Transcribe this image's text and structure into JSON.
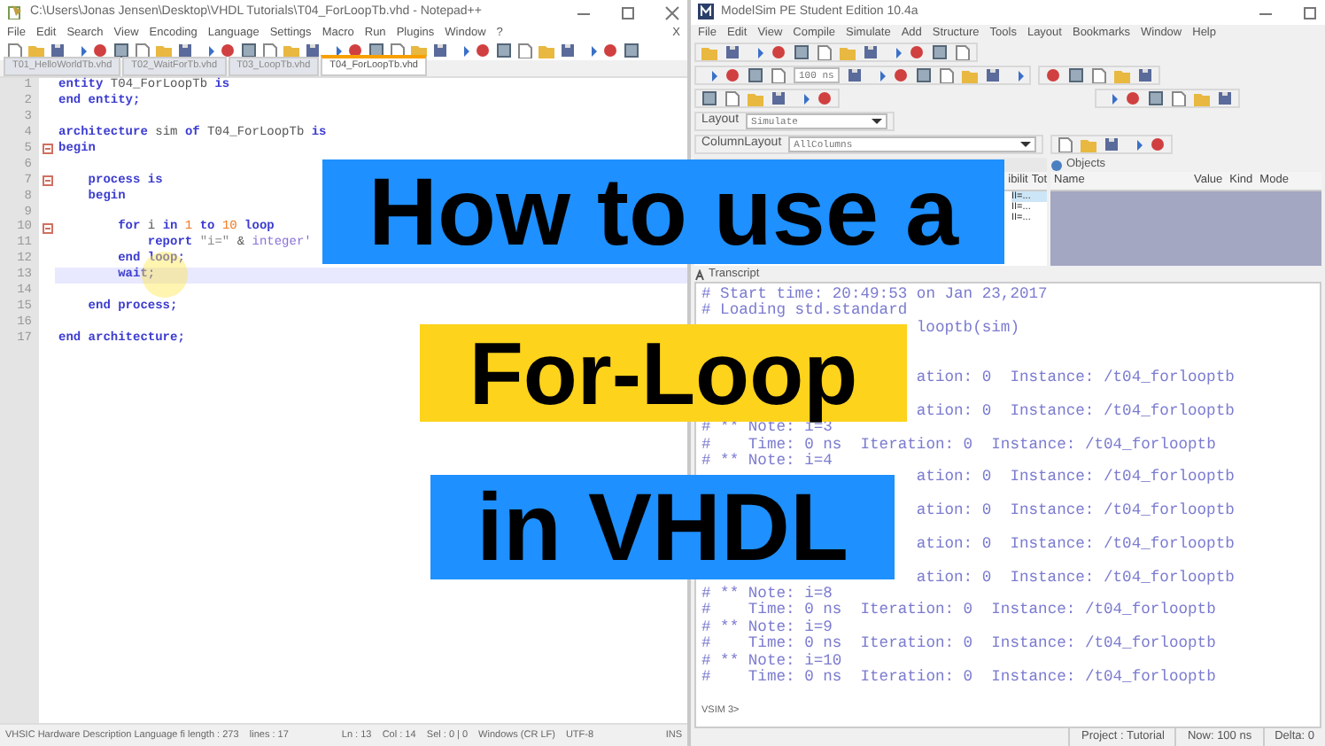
{
  "notepad": {
    "title": "C:\\Users\\Jonas Jensen\\Desktop\\VHDL Tutorials\\T04_ForLoopTb.vhd - Notepad++",
    "menu": [
      "File",
      "Edit",
      "Search",
      "View",
      "Encoding",
      "Language",
      "Settings",
      "Macro",
      "Run",
      "Plugins",
      "Window",
      "?"
    ],
    "close_doc": "X",
    "tabs": [
      {
        "label": "T01_HelloWorldTb.vhd",
        "selected": false
      },
      {
        "label": "T02_WaitForTb.vhd",
        "selected": false
      },
      {
        "label": "T03_LoopTb.vhd",
        "selected": false
      },
      {
        "label": "T04_ForLoopTb.vhd",
        "selected": true
      }
    ],
    "lines": [
      {
        "number": "1",
        "fold": false,
        "current": false,
        "tokens": [
          {
            "text": "entity",
            "kind": "kw"
          },
          {
            "text": " T04_ForLoopTb ",
            "kind": "id"
          },
          {
            "text": "is",
            "kind": "kw"
          }
        ]
      },
      {
        "number": "2",
        "fold": false,
        "current": false,
        "tokens": [
          {
            "text": "end entity;",
            "kind": "kw"
          }
        ]
      },
      {
        "number": "3",
        "fold": false,
        "current": false
      },
      {
        "number": "4",
        "fold": false,
        "current": false,
        "tokens": [
          {
            "text": "architecture",
            "kind": "kw"
          },
          {
            "text": " sim ",
            "kind": "id"
          },
          {
            "text": "of",
            "kind": "kw"
          },
          {
            "text": " T04_ForLoopTb ",
            "kind": "id"
          },
          {
            "text": "is",
            "kind": "kw"
          }
        ]
      },
      {
        "number": "5",
        "fold": true,
        "current": false,
        "tokens": [
          {
            "text": "begin",
            "kind": "kw"
          }
        ]
      },
      {
        "number": "6",
        "fold": false,
        "current": false
      },
      {
        "number": "7",
        "fold": true,
        "current": false,
        "tokens": [
          {
            "text": "    process is",
            "kind": "kw"
          }
        ]
      },
      {
        "number": "8",
        "fold": false,
        "current": false,
        "tokens": [
          {
            "text": "    begin",
            "kind": "kw"
          }
        ]
      },
      {
        "number": "9",
        "fold": false,
        "current": false
      },
      {
        "number": "10",
        "fold": true,
        "current": false,
        "tokens": [
          {
            "text": "        for",
            "kind": "kw"
          },
          {
            "text": " i ",
            "kind": "id"
          },
          {
            "text": "in",
            "kind": "kw"
          },
          {
            "text": " 1",
            "kind": "num"
          },
          {
            "text": " to",
            "kind": "kw"
          },
          {
            "text": " 10",
            "kind": "num"
          },
          {
            "text": " loop",
            "kind": "kw"
          }
        ]
      },
      {
        "number": "11",
        "fold": false,
        "current": false,
        "tokens": [
          {
            "text": "            report",
            "kind": "kw"
          },
          {
            "text": " \"i=\"",
            "kind": "str"
          },
          {
            "text": " & ",
            "kind": "id"
          },
          {
            "text": "integer'",
            "kind": "type"
          }
        ]
      },
      {
        "number": "12",
        "fold": false,
        "current": false,
        "tokens": [
          {
            "text": "        end loop;",
            "kind": "kw"
          }
        ]
      },
      {
        "number": "13",
        "fold": false,
        "current": true,
        "tokens": [
          {
            "text": "        wait;",
            "kind": "kw"
          }
        ]
      },
      {
        "number": "14",
        "fold": false,
        "current": false
      },
      {
        "number": "15",
        "fold": false,
        "current": false,
        "tokens": [
          {
            "text": "    end process;",
            "kind": "kw"
          }
        ]
      },
      {
        "number": "16",
        "fold": false,
        "current": false
      },
      {
        "number": "17",
        "fold": false,
        "current": false,
        "tokens": [
          {
            "text": "end architecture;",
            "kind": "kw"
          }
        ]
      }
    ],
    "status": [
      "VHSIC Hardware Description Language fi length : 273    lines : 17",
      "Ln : 13    Col : 14    Sel : 0 | 0",
      "Windows (CR LF)",
      "UTF-8",
      "INS"
    ]
  },
  "modelsim": {
    "title": "ModelSim PE Student Edition 10.4a",
    "menu": [
      "File",
      "Edit",
      "View",
      "Compile",
      "Simulate",
      "Add",
      "Structure",
      "Tools",
      "Layout",
      "Bookmarks",
      "Window",
      "Help"
    ],
    "run_length": "100 ns",
    "layout": {
      "label": "Layout",
      "value": "Simulate"
    },
    "column_layout": {
      "label": "ColumnLayout",
      "value": "AllColumns"
    },
    "instance_pane": {
      "columns": [
        "ibilit",
        "Tot"
      ],
      "rows": [
        {
          "text": "II=...",
          "selected": true
        },
        {
          "text": "II=...",
          "selected": false
        },
        {
          "text": "II=...",
          "selected": false
        }
      ]
    },
    "objects": {
      "title": "Objects",
      "columns": [
        "Name",
        "Value",
        "Kind",
        "Mode"
      ]
    },
    "transcript": {
      "title": "Transcript",
      "lines": [
        {
          "kind": "full",
          "text": "# Start time: 20:49:53 on Jan 23,2017"
        },
        {
          "kind": "full",
          "text": "# Loading std.standard"
        },
        {
          "kind": "tail",
          "text": "looptb(sim)"
        },
        {
          "kind": "covered"
        },
        {
          "kind": "covered"
        },
        {
          "kind": "tail",
          "text": "ation: 0  Instance: /t04_forlooptb"
        },
        {
          "kind": "covered"
        },
        {
          "kind": "tail",
          "text": "ation: 0  Instance: /t04_forlooptb"
        },
        {
          "kind": "full",
          "text": "# ** Note: i=3"
        },
        {
          "kind": "full",
          "text": "#    Time: 0 ns  Iteration: 0  Instance: /t04_forlooptb"
        },
        {
          "kind": "full",
          "text": "# ** Note: i=4"
        },
        {
          "kind": "tail",
          "text": "ation: 0  Instance: /t04_forlooptb"
        },
        {
          "kind": "covered"
        },
        {
          "kind": "tail",
          "text": "ation: 0  Instance: /t04_forlooptb"
        },
        {
          "kind": "covered"
        },
        {
          "kind": "tail",
          "text": "ation: 0  Instance: /t04_forlooptb"
        },
        {
          "kind": "covered"
        },
        {
          "kind": "tail",
          "text": "ation: 0  Instance: /t04_forlooptb"
        },
        {
          "kind": "full",
          "text": "# ** Note: i=8"
        },
        {
          "kind": "full",
          "text": "#    Time: 0 ns  Iteration: 0  Instance: /t04_forlooptb"
        },
        {
          "kind": "full",
          "text": "# ** Note: i=9"
        },
        {
          "kind": "full",
          "text": "#    Time: 0 ns  Iteration: 0  Instance: /t04_forlooptb"
        },
        {
          "kind": "full",
          "text": "# ** Note: i=10"
        },
        {
          "kind": "full",
          "text": "#    Time: 0 ns  Iteration: 0  Instance: /t04_forlooptb"
        }
      ],
      "prompt": "VSIM 3>"
    },
    "status": [
      "Project : Tutorial",
      "Now: 100 ns",
      "Delta: 0"
    ]
  },
  "banners": [
    {
      "text": "How to use a",
      "color": "#1e90ff"
    },
    {
      "text": "For-Loop",
      "color": "#fdd31c"
    },
    {
      "text": "in VHDL",
      "color": "#1e90ff"
    }
  ]
}
